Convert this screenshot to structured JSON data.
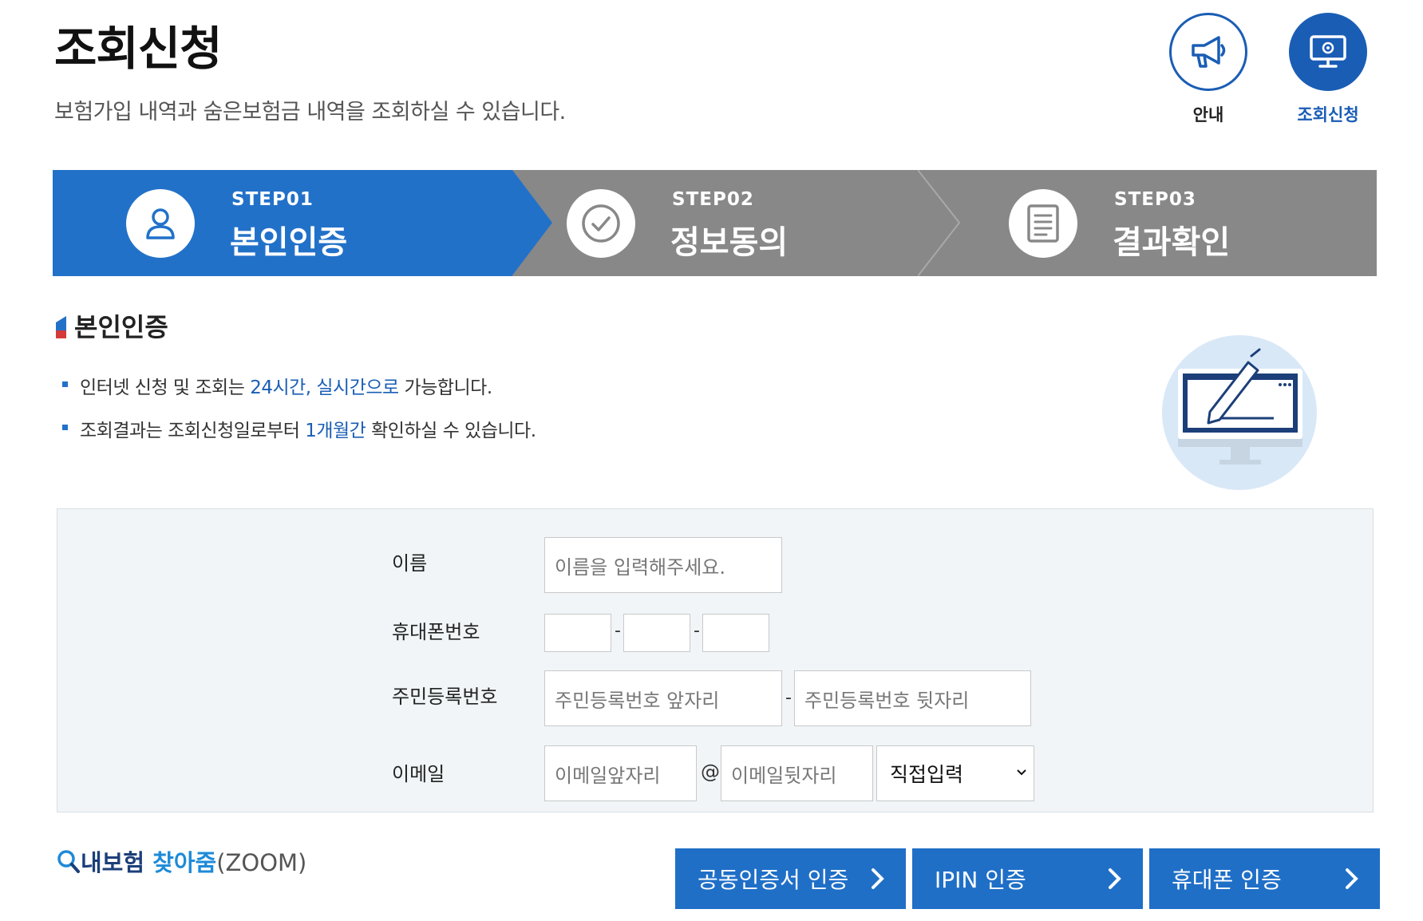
{
  "header": {
    "title": "조회신청",
    "description": "보험가입 내역과 숨은보험금 내역을 조회하실 수 있습니다.",
    "shortcuts": [
      {
        "label": "안내",
        "icon": "megaphone-icon"
      },
      {
        "label": "조회신청",
        "icon": "monitor-gear-icon"
      }
    ]
  },
  "steps": [
    {
      "num": "STEP01",
      "name": "본인인증",
      "icon": "user-icon",
      "active": true
    },
    {
      "num": "STEP02",
      "name": "정보동의",
      "icon": "check-circle-icon",
      "active": false
    },
    {
      "num": "STEP03",
      "name": "결과확인",
      "icon": "document-icon",
      "active": false
    }
  ],
  "section": {
    "title": "본인인증",
    "bullets": [
      {
        "pre": "인터넷 신청 및 조회는 ",
        "highlight": "24시간, 실시간으로",
        "post": " 가능합니다."
      },
      {
        "pre": "조회결과는 조회신청일로부터 ",
        "highlight": "1개월간",
        "post": " 확인하실 수 있습니다."
      }
    ]
  },
  "form": {
    "name_label": "이름",
    "name_placeholder": "이름을 입력해주세요.",
    "phone_label": "휴대폰번호",
    "phone_sep": "-",
    "rrn_label": "주민등록번호",
    "rrn_front_placeholder": "주민등록번호 앞자리",
    "rrn_back_placeholder": "주민등록번호 뒷자리",
    "rrn_sep": "-",
    "email_label": "이메일",
    "email_front_placeholder": "이메일앞자리",
    "email_at": "@",
    "email_domain_placeholder": "이메일뒷자리",
    "email_select_value": "직접입력"
  },
  "zoom_link": {
    "part1": "내보험",
    "part2": "찾아줌",
    "part3": "(ZOOM)"
  },
  "auth_buttons": [
    {
      "label": "공동인증서 인증"
    },
    {
      "label": "IPIN 인증"
    },
    {
      "label": "휴대폰 인증"
    }
  ],
  "colors": {
    "primary": "#2271c9",
    "inactive_step": "#888888",
    "form_bg": "#f1f5f8"
  }
}
